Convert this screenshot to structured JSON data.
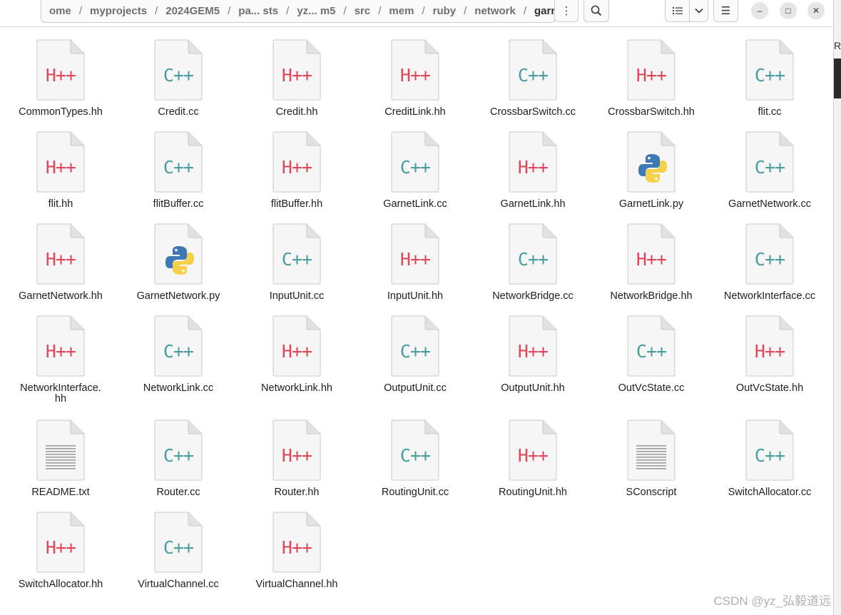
{
  "path": {
    "crumbs": [
      "ome",
      "myprojects",
      "2024GEM5",
      "pa... sts",
      "yz... m5",
      "src",
      "mem",
      "ruby",
      "network",
      "garnet"
    ],
    "separator": "/"
  },
  "toolbar": {
    "menu_icon": "⋮",
    "search_icon": "search-icon",
    "list_view_icon": "list-icon",
    "view_dropdown_icon": "chevron-down-icon",
    "hamburger_icon": "☰",
    "minimize": "–",
    "maximize": "□",
    "close": "✕"
  },
  "files": [
    {
      "name": "CommonTypes.hh",
      "type": "hpp"
    },
    {
      "name": "Credit.cc",
      "type": "cpp"
    },
    {
      "name": "Credit.hh",
      "type": "hpp"
    },
    {
      "name": "CreditLink.hh",
      "type": "hpp"
    },
    {
      "name": "CrossbarSwitch.cc",
      "type": "cpp"
    },
    {
      "name": "CrossbarSwitch.hh",
      "type": "hpp"
    },
    {
      "name": "flit.cc",
      "type": "cpp"
    },
    {
      "name": "flit.hh",
      "type": "hpp"
    },
    {
      "name": "flitBuffer.cc",
      "type": "cpp"
    },
    {
      "name": "flitBuffer.hh",
      "type": "hpp"
    },
    {
      "name": "GarnetLink.cc",
      "type": "cpp"
    },
    {
      "name": "GarnetLink.hh",
      "type": "hpp"
    },
    {
      "name": "GarnetLink.py",
      "type": "py"
    },
    {
      "name": "GarnetNetwork.cc",
      "type": "cpp"
    },
    {
      "name": "GarnetNetwork.hh",
      "type": "hpp"
    },
    {
      "name": "GarnetNetwork.py",
      "type": "py"
    },
    {
      "name": "InputUnit.cc",
      "type": "cpp"
    },
    {
      "name": "InputUnit.hh",
      "type": "hpp"
    },
    {
      "name": "NetworkBridge.cc",
      "type": "cpp"
    },
    {
      "name": "NetworkBridge.hh",
      "type": "hpp"
    },
    {
      "name": "NetworkInterface.cc",
      "type": "cpp"
    },
    {
      "name": "NetworkInterface.\nhh",
      "type": "hpp"
    },
    {
      "name": "NetworkLink.cc",
      "type": "cpp"
    },
    {
      "name": "NetworkLink.hh",
      "type": "hpp"
    },
    {
      "name": "OutputUnit.cc",
      "type": "cpp"
    },
    {
      "name": "OutputUnit.hh",
      "type": "hpp"
    },
    {
      "name": "OutVcState.cc",
      "type": "cpp"
    },
    {
      "name": "OutVcState.hh",
      "type": "hpp"
    },
    {
      "name": "README.txt",
      "type": "txt"
    },
    {
      "name": "Router.cc",
      "type": "cpp"
    },
    {
      "name": "Router.hh",
      "type": "hpp"
    },
    {
      "name": "RoutingUnit.cc",
      "type": "cpp"
    },
    {
      "name": "RoutingUnit.hh",
      "type": "hpp"
    },
    {
      "name": "SConscript",
      "type": "txt"
    },
    {
      "name": "SwitchAllocator.cc",
      "type": "cpp"
    },
    {
      "name": "SwitchAllocator.hh",
      "type": "hpp"
    },
    {
      "name": "VirtualChannel.cc",
      "type": "cpp"
    },
    {
      "name": "VirtualChannel.hh",
      "type": "hpp"
    }
  ],
  "labels": {
    "hpp": "H++",
    "cpp": "C++"
  },
  "colors": {
    "hpp": "#e0475a",
    "cpp": "#4b9ea0"
  },
  "side_letter": "R",
  "watermark": "CSDN @yz_弘毅道远"
}
